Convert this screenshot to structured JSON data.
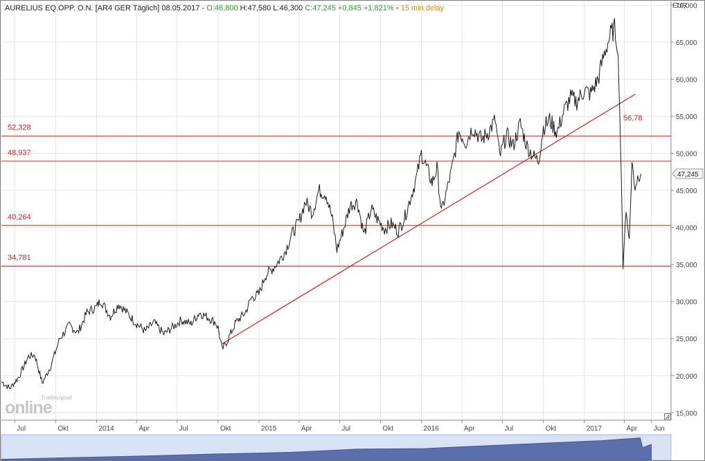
{
  "header": {
    "title": "AURELIUS EQ.OPP. O.N. [AR4 GER Täglich] 08.05.2017",
    "open": "O:46,800",
    "high": "H:47,580",
    "low": "L:46,300",
    "close": "C:47,245",
    "change": "+0,845",
    "change_pct": "+1,821%",
    "delay": "• 15 min delay"
  },
  "currency": "EUR",
  "price_tag": "47,245",
  "logo": {
    "brand": "Tradesignal",
    "product": "online"
  },
  "colors": {
    "price": "#1a1a1a",
    "lines": "#d42020",
    "grid": "#e4e4e4",
    "navigator": "#5b6fad",
    "up": "#2ca02c",
    "delay": "#e08a00"
  },
  "chart_data": {
    "type": "line",
    "title": "AURELIUS EQ.OPP. O.N. [AR4 GER Täglich] 08.05.2017",
    "ylabel": "EUR",
    "ylim": [
      14000,
      70500
    ],
    "y_scale": "linear",
    "y_ticks": [
      "15,000",
      "20,000",
      "25,000",
      "30,000",
      "35,000",
      "40,000",
      "45,000",
      "50,000",
      "55,000",
      "60,000",
      "65,000",
      "70,000"
    ],
    "x_ticks": [
      {
        "label": "Jul",
        "date": "2013-07-01"
      },
      {
        "label": "Okt",
        "date": "2013-10-01"
      },
      {
        "label": "2014",
        "date": "2014-01-01"
      },
      {
        "label": "Apr",
        "date": "2014-04-01"
      },
      {
        "label": "Jul",
        "date": "2014-07-01"
      },
      {
        "label": "Okt",
        "date": "2014-10-01"
      },
      {
        "label": "2015",
        "date": "2015-01-01"
      },
      {
        "label": "Apr",
        "date": "2015-04-01"
      },
      {
        "label": "Jul",
        "date": "2015-07-01"
      },
      {
        "label": "Okt",
        "date": "2015-10-01"
      },
      {
        "label": "2016",
        "date": "2016-01-01"
      },
      {
        "label": "Apr",
        "date": "2016-04-01"
      },
      {
        "label": "Jul",
        "date": "2016-07-01"
      },
      {
        "label": "Okt",
        "date": "2016-10-01"
      },
      {
        "label": "2017",
        "date": "2017-01-01"
      },
      {
        "label": "Apr",
        "date": "2017-04-01"
      },
      {
        "label": "Jun",
        "date": "2017-06-01"
      }
    ],
    "x_range": [
      "2013-06-01",
      "2017-07-15"
    ],
    "grid": true,
    "series": [
      {
        "points": [
          [
            "2013-06-01",
            19.2
          ],
          [
            "2013-06-20",
            18.3
          ],
          [
            "2013-07-10",
            19.8
          ],
          [
            "2013-08-01",
            22.6
          ],
          [
            "2013-08-15",
            22.8
          ],
          [
            "2013-09-01",
            19.0
          ],
          [
            "2013-09-20",
            21.3
          ],
          [
            "2013-10-10",
            25.0
          ],
          [
            "2013-11-01",
            26.8
          ],
          [
            "2013-11-20",
            25.8
          ],
          [
            "2013-12-10",
            28.5
          ],
          [
            "2014-01-01",
            29.3
          ],
          [
            "2014-01-10",
            30.2
          ],
          [
            "2014-02-01",
            28.0
          ],
          [
            "2014-02-20",
            29.7
          ],
          [
            "2014-03-10",
            28.5
          ],
          [
            "2014-04-01",
            27.0
          ],
          [
            "2014-04-20",
            26.0
          ],
          [
            "2014-05-10",
            27.2
          ],
          [
            "2014-06-01",
            25.6
          ],
          [
            "2014-06-20",
            26.5
          ],
          [
            "2014-07-10",
            27.5
          ],
          [
            "2014-08-01",
            27.0
          ],
          [
            "2014-08-20",
            28.5
          ],
          [
            "2014-09-10",
            27.8
          ],
          [
            "2014-09-25",
            27.2
          ],
          [
            "2014-10-01",
            26.5
          ],
          [
            "2014-10-10",
            23.5
          ],
          [
            "2014-10-20",
            24.5
          ],
          [
            "2014-11-10",
            27.2
          ],
          [
            "2014-12-01",
            28.5
          ],
          [
            "2014-12-15",
            30.5
          ],
          [
            "2015-01-01",
            31.0
          ],
          [
            "2015-01-15",
            33.5
          ],
          [
            "2015-02-01",
            34.5
          ],
          [
            "2015-02-15",
            35.5
          ],
          [
            "2015-03-01",
            36.8
          ],
          [
            "2015-03-15",
            39.0
          ],
          [
            "2015-04-01",
            40.8
          ],
          [
            "2015-04-15",
            43.5
          ],
          [
            "2015-05-01",
            42.0
          ],
          [
            "2015-05-15",
            45.0
          ],
          [
            "2015-06-01",
            44.5
          ],
          [
            "2015-06-15",
            41.0
          ],
          [
            "2015-06-25",
            37.0
          ],
          [
            "2015-07-10",
            39.8
          ],
          [
            "2015-07-25",
            43.0
          ],
          [
            "2015-08-10",
            43.5
          ],
          [
            "2015-08-25",
            39.0
          ],
          [
            "2015-09-10",
            42.5
          ],
          [
            "2015-09-25",
            41.0
          ],
          [
            "2015-10-10",
            39.8
          ],
          [
            "2015-10-25",
            40.5
          ],
          [
            "2015-11-10",
            39.5
          ],
          [
            "2015-11-25",
            41.5
          ],
          [
            "2015-12-10",
            44.5
          ],
          [
            "2015-12-20",
            46.5
          ],
          [
            "2016-01-01",
            50.0
          ],
          [
            "2016-01-10",
            48.5
          ],
          [
            "2016-01-25",
            46.0
          ],
          [
            "2016-02-05",
            48.0
          ],
          [
            "2016-02-15",
            42.0
          ],
          [
            "2016-02-25",
            44.5
          ],
          [
            "2016-03-10",
            48.0
          ],
          [
            "2016-03-25",
            53.0
          ],
          [
            "2016-04-10",
            51.5
          ],
          [
            "2016-04-25",
            53.5
          ],
          [
            "2016-05-15",
            51.8
          ],
          [
            "2016-06-01",
            53.0
          ],
          [
            "2016-06-15",
            54.5
          ],
          [
            "2016-06-25",
            49.5
          ],
          [
            "2016-07-10",
            52.5
          ],
          [
            "2016-07-25",
            51.0
          ],
          [
            "2016-08-10",
            54.0
          ],
          [
            "2016-08-25",
            51.0
          ],
          [
            "2016-09-10",
            49.5
          ],
          [
            "2016-09-20",
            49.0
          ],
          [
            "2016-10-01",
            53.5
          ],
          [
            "2016-10-15",
            54.5
          ],
          [
            "2016-11-01",
            52.8
          ],
          [
            "2016-11-15",
            55.5
          ],
          [
            "2016-12-01",
            57.5
          ],
          [
            "2016-12-15",
            57.0
          ],
          [
            "2017-01-01",
            58.5
          ],
          [
            "2017-01-15",
            58.0
          ],
          [
            "2017-02-01",
            60.0
          ],
          [
            "2017-02-15",
            63.5
          ],
          [
            "2017-03-01",
            66.0
          ],
          [
            "2017-03-10",
            66.8
          ],
          [
            "2017-03-16",
            65.0
          ],
          [
            "2017-03-20",
            60.0
          ],
          [
            "2017-03-23",
            52.0
          ],
          [
            "2017-03-27",
            41.0
          ],
          [
            "2017-03-29",
            35.0
          ],
          [
            "2017-04-01",
            38.5
          ],
          [
            "2017-04-05",
            42.0
          ],
          [
            "2017-04-10",
            40.0
          ],
          [
            "2017-04-12",
            38.0
          ],
          [
            "2017-04-18",
            48.7
          ],
          [
            "2017-04-25",
            45.5
          ],
          [
            "2017-05-03",
            47.2
          ],
          [
            "2017-05-08",
            47.245
          ]
        ]
      }
    ],
    "horizontal_lines": [
      {
        "label": "52,328",
        "value": 52.328
      },
      {
        "label": "48,937",
        "value": 48.937
      },
      {
        "label": "40,264",
        "value": 40.264
      },
      {
        "label": "34,781",
        "value": 34.781
      }
    ],
    "trendline": {
      "label": "56,78",
      "start": [
        "2014-10-10",
        24.3
      ],
      "end": [
        "2017-04-26",
        58.0
      ]
    },
    "navigator": {
      "points": [
        [
          "2010-01-01",
          1.0
        ],
        [
          "2010-10-01",
          2.5
        ],
        [
          "2011-08-01",
          4.0
        ],
        [
          "2012-06-01",
          6.0
        ],
        [
          "2013-04-01",
          7.5
        ],
        [
          "2014-01-01",
          10.5
        ],
        [
          "2014-10-01",
          11.0
        ],
        [
          "2015-06-01",
          13.5
        ],
        [
          "2016-02-01",
          16.0
        ],
        [
          "2016-10-01",
          18.5
        ],
        [
          "2017-03-10",
          21.0
        ],
        [
          "2017-03-20",
          12.0
        ],
        [
          "2017-04-25",
          15.0
        ]
      ],
      "x_range": [
        "2010-01-01",
        "2017-07-15"
      ]
    }
  }
}
